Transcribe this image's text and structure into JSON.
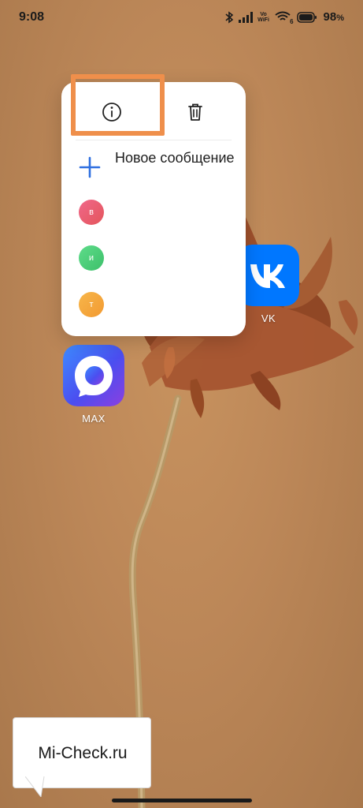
{
  "status_bar": {
    "time": "9:08",
    "volte_line1": "Vo",
    "volte_line2": "WiFi",
    "wifi_badge": "6",
    "battery": "98",
    "battery_unit": "%"
  },
  "popup": {
    "new_message_label": "Новое сообщение",
    "contacts": [
      {
        "initial": "в"
      },
      {
        "initial": "и"
      },
      {
        "initial": "т"
      }
    ]
  },
  "apps": {
    "vk_label": "VK",
    "max_label": "MAX"
  },
  "watermark": {
    "text": "Mi-Check.ru"
  },
  "colors": {
    "highlight": "#ef8f4b",
    "plus_accent": "#2f6fe0",
    "vk_brand": "#0077ff"
  }
}
